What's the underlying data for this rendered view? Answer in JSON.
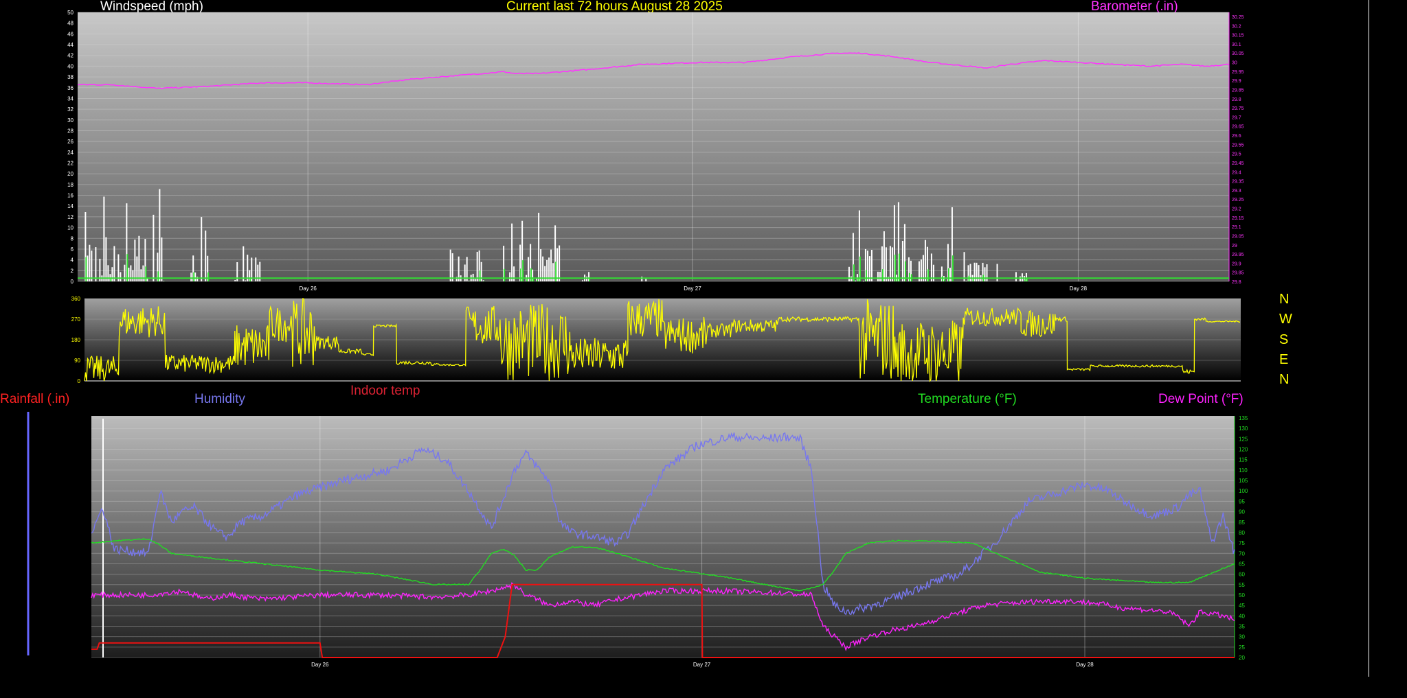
{
  "labels": {
    "title": "Current last 72 hours August 28 2025",
    "windspeed": "Windspeed (mph)",
    "barometer": "Barometer (.in)",
    "rainfall": "Rainfall (.in)",
    "humidity": "Humidity",
    "indoor_temp": "Indoor temp",
    "temperature": "Temperature (°F)",
    "dew_point": "Dew Point (°F)"
  },
  "colors": {
    "title": "#ffff00",
    "windspeed": "#ffffff",
    "wind_avg": "#33dd33",
    "barometer": "#ff33ff",
    "direction": "#ffff00",
    "rainfall": "#ff2222",
    "humidity": "#7777ee",
    "indoor_temp": "#dd2233",
    "temperature": "#22dd22",
    "dew_point": "#ff22ff",
    "compass": "#ffff00"
  },
  "compass": [
    "N",
    "W",
    "S",
    "E",
    "N"
  ],
  "chart_data": [
    {
      "type": "bar",
      "id": "wind",
      "x_label_ticks": [
        {
          "x": 0.2,
          "label": "Day 26"
        },
        {
          "x": 0.534,
          "label": "Day 27"
        },
        {
          "x": 0.869,
          "label": "Day 28"
        }
      ],
      "left_axis": {
        "label": "Windspeed (mph)",
        "ylim": [
          0,
          50
        ],
        "ticks": [
          "0",
          "2",
          "4",
          "6",
          "8",
          "10",
          "12",
          "14",
          "16",
          "18",
          "20",
          "22",
          "24",
          "26",
          "28",
          "30",
          "32",
          "34",
          "36",
          "38",
          "40",
          "42",
          "44",
          "46",
          "48",
          "50"
        ]
      },
      "right_axis": {
        "label": "Barometer (.in)",
        "ylim": [
          28.8,
          30.25
        ],
        "ticks": [
          "29.8",
          "29.85",
          "29.9",
          "29.95",
          "29",
          "29.05",
          "29.1",
          "29.15",
          "29.2",
          "29.25",
          "29.3",
          "29.35",
          "29.4",
          "29.45",
          "29.5",
          "29.55",
          "29.6",
          "29.65",
          "29.7",
          "29.75",
          "29.8",
          "29.85",
          "29.9",
          "29.95",
          "30",
          "30.05",
          "30.1",
          "30.15",
          "30.2",
          "30.25"
        ]
      },
      "gust_bursts": [
        {
          "start": 0.005,
          "end": 0.075,
          "peak": 18,
          "typ": 9
        },
        {
          "start": 0.095,
          "end": 0.115,
          "peak": 14,
          "typ": 7
        },
        {
          "start": 0.135,
          "end": 0.16,
          "peak": 10,
          "typ": 5
        },
        {
          "start": 0.322,
          "end": 0.36,
          "peak": 12,
          "typ": 6
        },
        {
          "start": 0.37,
          "end": 0.42,
          "peak": 14,
          "typ": 7
        },
        {
          "start": 0.435,
          "end": 0.445,
          "peak": 3,
          "typ": 2
        },
        {
          "start": 0.49,
          "end": 0.495,
          "peak": 4,
          "typ": 2
        },
        {
          "start": 0.67,
          "end": 0.76,
          "peak": 15,
          "typ": 8
        },
        {
          "start": 0.77,
          "end": 0.8,
          "peak": 8,
          "typ": 4
        },
        {
          "start": 0.815,
          "end": 0.825,
          "peak": 4,
          "typ": 2
        }
      ],
      "barometer_series": {
        "name": "Barometer (.in)",
        "x": [
          0,
          0.03,
          0.07,
          0.11,
          0.16,
          0.2,
          0.25,
          0.29,
          0.33,
          0.37,
          0.38,
          0.4,
          0.44,
          0.49,
          0.54,
          0.58,
          0.62,
          0.66,
          0.68,
          0.71,
          0.74,
          0.79,
          0.81,
          0.84,
          0.87,
          0.9,
          0.93,
          0.96,
          0.98,
          1.0
        ],
        "y": [
          29.86,
          29.86,
          29.84,
          29.85,
          29.87,
          29.87,
          29.86,
          29.89,
          29.91,
          29.93,
          29.92,
          29.92,
          29.94,
          29.97,
          29.98,
          29.98,
          30.01,
          30.03,
          30.03,
          30.01,
          29.98,
          29.95,
          29.97,
          29.99,
          29.98,
          29.97,
          29.96,
          29.97,
          29.96,
          29.97
        ]
      },
      "wind_avg_level": 0.6
    },
    {
      "type": "line",
      "id": "direction",
      "ylim": [
        0,
        360
      ],
      "ticks": [
        "0",
        "90",
        "180",
        "270",
        "360"
      ],
      "segments": [
        {
          "start": 0.0,
          "end": 0.03,
          "base": 50,
          "amp": 60
        },
        {
          "start": 0.03,
          "end": 0.07,
          "base": 260,
          "amp": 70
        },
        {
          "start": 0.07,
          "end": 0.13,
          "base": 75,
          "amp": 40
        },
        {
          "start": 0.13,
          "end": 0.16,
          "base": 150,
          "amp": 100
        },
        {
          "start": 0.16,
          "end": 0.18,
          "base": 250,
          "amp": 80
        },
        {
          "start": 0.18,
          "end": 0.2,
          "base": 210,
          "amp": 150
        },
        {
          "start": 0.2,
          "end": 0.22,
          "base": 170,
          "amp": 30
        },
        {
          "start": 0.22,
          "end": 0.24,
          "base": 130,
          "amp": 10
        },
        {
          "start": 0.24,
          "end": 0.25,
          "base": 115,
          "amp": 5
        },
        {
          "start": 0.25,
          "end": 0.27,
          "base": 240,
          "amp": 5
        },
        {
          "start": 0.27,
          "end": 0.3,
          "base": 80,
          "amp": 8
        },
        {
          "start": 0.3,
          "end": 0.31,
          "base": 72,
          "amp": 5
        },
        {
          "start": 0.31,
          "end": 0.33,
          "base": 70,
          "amp": 4
        },
        {
          "start": 0.33,
          "end": 0.36,
          "base": 240,
          "amp": 90
        },
        {
          "start": 0.36,
          "end": 0.42,
          "base": 170,
          "amp": 170
        },
        {
          "start": 0.42,
          "end": 0.47,
          "base": 110,
          "amp": 80
        },
        {
          "start": 0.47,
          "end": 0.5,
          "base": 270,
          "amp": 90
        },
        {
          "start": 0.5,
          "end": 0.54,
          "base": 200,
          "amp": 80
        },
        {
          "start": 0.54,
          "end": 0.56,
          "base": 220,
          "amp": 30
        },
        {
          "start": 0.56,
          "end": 0.6,
          "base": 240,
          "amp": 30
        },
        {
          "start": 0.6,
          "end": 0.67,
          "base": 270,
          "amp": 10
        },
        {
          "start": 0.67,
          "end": 0.7,
          "base": 180,
          "amp": 180
        },
        {
          "start": 0.7,
          "end": 0.76,
          "base": 120,
          "amp": 150
        },
        {
          "start": 0.76,
          "end": 0.81,
          "base": 280,
          "amp": 40
        },
        {
          "start": 0.81,
          "end": 0.84,
          "base": 250,
          "amp": 60
        },
        {
          "start": 0.84,
          "end": 0.85,
          "base": 270,
          "amp": 10
        },
        {
          "start": 0.85,
          "end": 0.87,
          "base": 50,
          "amp": 5
        },
        {
          "start": 0.87,
          "end": 0.95,
          "base": 65,
          "amp": 5
        },
        {
          "start": 0.95,
          "end": 0.96,
          "base": 40,
          "amp": 10
        },
        {
          "start": 0.96,
          "end": 0.97,
          "base": 270,
          "amp": 5
        },
        {
          "start": 0.97,
          "end": 1.0,
          "base": 260,
          "amp": 3
        }
      ]
    },
    {
      "type": "line",
      "id": "climate",
      "x_label_ticks": [
        {
          "x": 0.2,
          "label": "Day 26"
        },
        {
          "x": 0.534,
          "label": "Day 27"
        },
        {
          "x": 0.869,
          "label": "Day 28"
        }
      ],
      "right_axis": {
        "ylim": [
          20,
          136
        ],
        "ticks": [
          "20",
          "25",
          "30",
          "35",
          "40",
          "45",
          "50",
          "55",
          "60",
          "65",
          "70",
          "75",
          "80",
          "85",
          "90",
          "95",
          "100",
          "105",
          "110",
          "115",
          "120",
          "125",
          "130",
          "135"
        ]
      },
      "series": [
        {
          "name": "Humidity",
          "x": [
            0.0,
            0.01,
            0.02,
            0.05,
            0.06,
            0.07,
            0.08,
            0.09,
            0.11,
            0.12,
            0.13,
            0.15,
            0.18,
            0.22,
            0.26,
            0.29,
            0.31,
            0.33,
            0.35,
            0.37,
            0.38,
            0.4,
            0.41,
            0.42,
            0.44,
            0.46,
            0.47,
            0.5,
            0.53,
            0.56,
            0.59,
            0.61,
            0.62,
            0.63,
            0.64,
            0.65,
            0.66,
            0.67,
            0.7,
            0.73,
            0.76,
            0.79,
            0.82,
            0.85,
            0.87,
            0.89,
            0.9,
            0.92,
            0.93,
            0.95,
            0.96,
            0.97,
            0.98,
            0.99,
            1.0
          ],
          "y": [
            80,
            92,
            72,
            70,
            100,
            85,
            90,
            92,
            80,
            78,
            85,
            88,
            98,
            105,
            110,
            120,
            115,
            100,
            82,
            110,
            118,
            105,
            85,
            80,
            78,
            75,
            80,
            110,
            122,
            126,
            125,
            126,
            125,
            110,
            55,
            45,
            42,
            43,
            48,
            55,
            60,
            75,
            95,
            100,
            103,
            100,
            96,
            90,
            88,
            92,
            98,
            100,
            75,
            88,
            70
          ]
        },
        {
          "name": "Temperature (°F)",
          "x": [
            0.0,
            0.02,
            0.05,
            0.06,
            0.07,
            0.1,
            0.15,
            0.2,
            0.25,
            0.3,
            0.33,
            0.34,
            0.35,
            0.36,
            0.37,
            0.38,
            0.39,
            0.4,
            0.42,
            0.44,
            0.46,
            0.5,
            0.55,
            0.6,
            0.62,
            0.64,
            0.65,
            0.66,
            0.68,
            0.7,
            0.73,
            0.77,
            0.8,
            0.83,
            0.87,
            0.9,
            0.93,
            0.96,
            1.0
          ],
          "y": [
            75,
            76,
            77,
            74,
            70,
            68,
            65,
            62,
            60,
            55,
            55,
            62,
            70,
            72,
            69,
            62,
            62,
            68,
            73,
            73,
            70,
            63,
            59,
            54,
            52,
            55,
            62,
            70,
            75,
            76,
            76,
            75,
            68,
            61,
            58,
            57,
            56,
            56,
            65
          ]
        },
        {
          "name": "Dew Point (°F)",
          "x": [
            0.0,
            0.05,
            0.08,
            0.1,
            0.12,
            0.15,
            0.2,
            0.25,
            0.3,
            0.33,
            0.35,
            0.37,
            0.38,
            0.39,
            0.4,
            0.42,
            0.44,
            0.46,
            0.5,
            0.55,
            0.6,
            0.63,
            0.64,
            0.66,
            0.68,
            0.7,
            0.72,
            0.75,
            0.78,
            0.8,
            0.83,
            0.86,
            0.88,
            0.9,
            0.92,
            0.94,
            0.95,
            0.96,
            0.97,
            0.99,
            1.0
          ],
          "y": [
            50,
            50,
            52,
            48,
            50,
            48,
            50,
            50,
            49,
            50,
            52,
            55,
            50,
            48,
            45,
            47,
            45,
            48,
            52,
            52,
            51,
            50,
            35,
            25,
            30,
            33,
            35,
            40,
            45,
            46,
            47,
            47,
            46,
            44,
            43,
            42,
            40,
            35,
            42,
            40,
            38
          ]
        },
        {
          "name": "Indoor temp",
          "step": true,
          "x": [
            0.0,
            0.005,
            0.007,
            0.2,
            0.202,
            0.355,
            0.362,
            0.368,
            0.534,
            0.5345,
            1.0
          ],
          "y": [
            24,
            24,
            27,
            27,
            20,
            20,
            30,
            55,
            55,
            20,
            20
          ]
        }
      ]
    }
  ]
}
